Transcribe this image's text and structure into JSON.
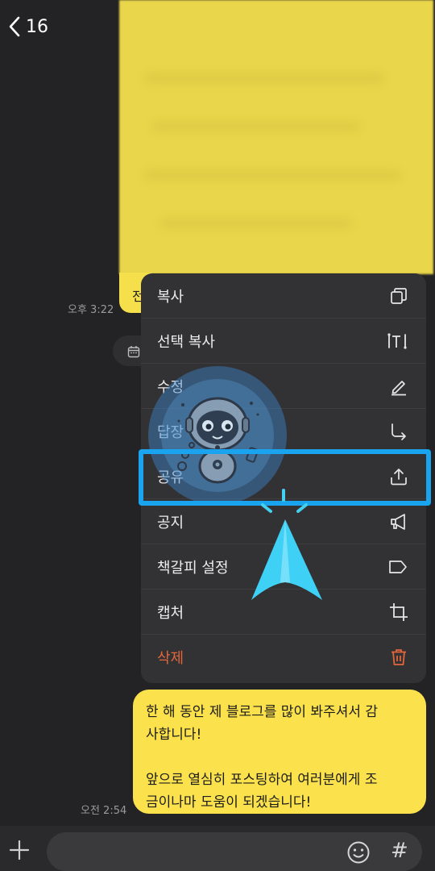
{
  "header": {
    "back_count": "16"
  },
  "chat": {
    "partial_bubble_char": "전",
    "time_first": "오후 3:22",
    "time_second": "오전 2:54",
    "message_lines": [
      "한 해 동안 제 블로그를 많이 봐주셔서 감",
      "사합니다!",
      "앞으로 열심히 포스팅하여 여러분에게 조",
      "금이나마 도움이 되겠습니다!"
    ]
  },
  "context_menu": {
    "items": [
      {
        "label": "복사",
        "icon": "copy-icon"
      },
      {
        "label": "선택 복사",
        "icon": "select-text-icon"
      },
      {
        "label": "수정",
        "icon": "pencil-icon"
      },
      {
        "label": "답장",
        "icon": "reply-arrow-icon"
      },
      {
        "label": "공유",
        "icon": "share-icon"
      },
      {
        "label": "공지",
        "icon": "megaphone-icon"
      },
      {
        "label": "책갈피 설정",
        "icon": "bookmark-tag-icon"
      },
      {
        "label": "캡처",
        "icon": "crop-icon"
      },
      {
        "label": "삭제",
        "icon": "trash-icon"
      }
    ],
    "highlighted_item": "공유"
  },
  "colors": {
    "background": "#232325",
    "menu_background": "#323235",
    "bubble_yellow": "#fbe24c",
    "highlight_blue": "#1aa4f0",
    "danger": "#e2663b"
  },
  "input_bar": {
    "left_icon": "plus-icon",
    "right_icons": [
      "emoji-icon",
      "hash-icon"
    ],
    "hash_label": "#"
  }
}
